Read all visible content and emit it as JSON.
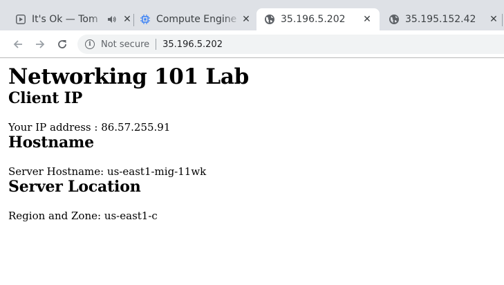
{
  "browser": {
    "tabs": [
      {
        "title": "It's Ok — Tom",
        "icon": "play-icon",
        "audio_icon": "speaker-icon",
        "active": false
      },
      {
        "title": "Compute Engine -",
        "icon": "compute-engine-icon",
        "active": false
      },
      {
        "title": "35.196.5.202",
        "icon": "globe-icon",
        "active": true
      },
      {
        "title": "35.195.152.42",
        "icon": "globe-icon",
        "active": false
      }
    ],
    "security_label": "Not secure",
    "url": "35.196.5.202"
  },
  "page": {
    "title": "Networking 101 Lab",
    "sections": [
      {
        "heading": "Client IP",
        "text": "Your IP address : 86.57.255.91"
      },
      {
        "heading": "Hostname",
        "text": "Server Hostname: us-east1-mig-11wk"
      },
      {
        "heading": "Server Location",
        "text": "Region and Zone: us-east1-c"
      }
    ]
  },
  "colors": {
    "tabstrip_bg": "#dee1e6",
    "toolbar_bg": "#ffffff",
    "omnibox_bg": "#f1f3f4",
    "compute_engine_blue": "#4285f4"
  }
}
